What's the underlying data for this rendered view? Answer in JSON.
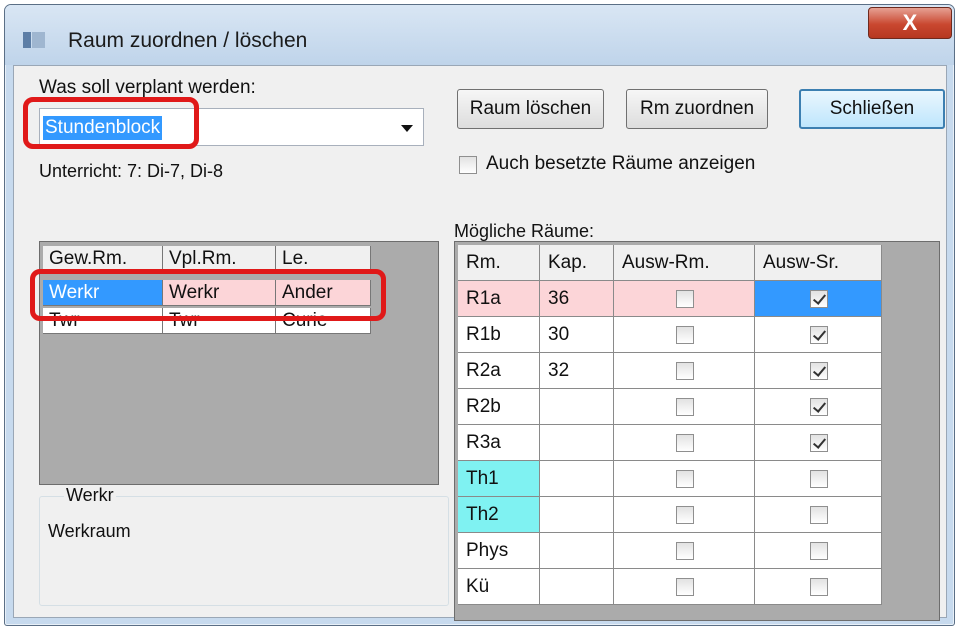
{
  "window": {
    "title": "Raum zuordnen / löschen",
    "close_label": "X"
  },
  "form": {
    "label_what": "Was soll verplant werden:",
    "combo_value": "Stundenblock",
    "unterricht": "Unterricht: 7: Di-7, Di-8",
    "checkbox_label": "Auch besetzte Räume anzeigen",
    "moegliche_label": "Mögliche Räume:"
  },
  "buttons": {
    "raum_loeschen": "Raum löschen",
    "rm_zuordnen": "Rm zuordnen",
    "schliessen": "Schließen"
  },
  "left_table": {
    "columns": [
      "Gew.Rm.",
      "Vpl.Rm.",
      "Le."
    ],
    "rows": [
      [
        "Werkr",
        "Werkr",
        "Ander"
      ],
      [
        "Twr",
        "Twr",
        "Curie"
      ]
    ]
  },
  "info_group": {
    "title": "Werkr",
    "text": "Werkraum"
  },
  "rooms_table": {
    "columns": [
      "Rm.",
      "Kap.",
      "Ausw-Rm.",
      "Ausw-Sr."
    ],
    "rows": [
      {
        "rm": "R1a",
        "kap": "36",
        "ausw_rm": false,
        "ausw_sr": true
      },
      {
        "rm": "R1b",
        "kap": "30",
        "ausw_rm": false,
        "ausw_sr": true
      },
      {
        "rm": "R2a",
        "kap": "32",
        "ausw_rm": false,
        "ausw_sr": true
      },
      {
        "rm": "R2b",
        "kap": "",
        "ausw_rm": false,
        "ausw_sr": true
      },
      {
        "rm": "R3a",
        "kap": "",
        "ausw_rm": false,
        "ausw_sr": true
      },
      {
        "rm": "Th1",
        "kap": "",
        "ausw_rm": false,
        "ausw_sr": false
      },
      {
        "rm": "Th2",
        "kap": "",
        "ausw_rm": false,
        "ausw_sr": false
      },
      {
        "rm": "Phys",
        "kap": "",
        "ausw_rm": false,
        "ausw_sr": false
      },
      {
        "rm": "Kü",
        "kap": "",
        "ausw_rm": false,
        "ausw_sr": false
      }
    ]
  },
  "colors": {
    "selection_blue": "#3399ff",
    "row_pink": "#fcd5d8",
    "cyan_cell": "#7ff2f2",
    "annotation_red": "#e01919"
  }
}
